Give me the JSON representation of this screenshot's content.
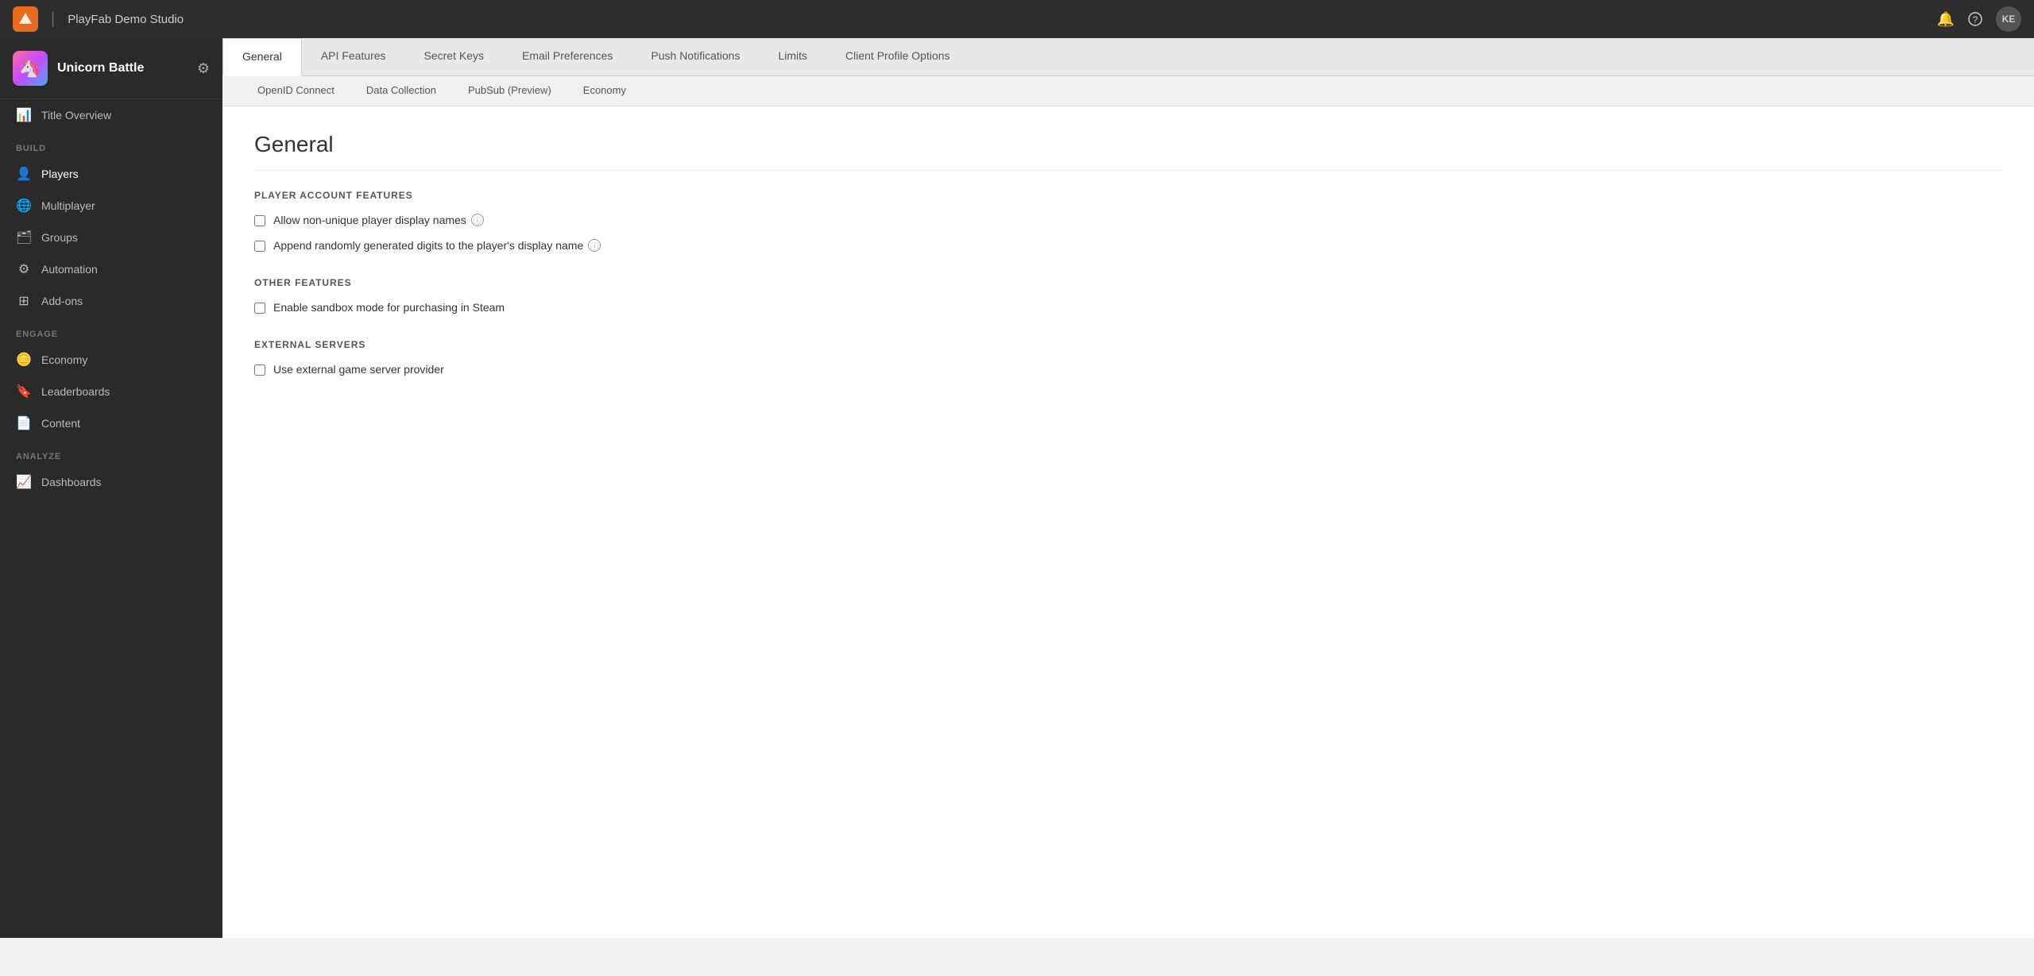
{
  "topbar": {
    "logo_text": "▲",
    "studio_name": "PlayFab Demo Studio",
    "avatar_text": "KE"
  },
  "sidebar": {
    "game_icon": "🦄",
    "game_title": "Unicorn Battle",
    "title_overview_label": "Title Overview",
    "section_build": "BUILD",
    "nav_players": "Players",
    "nav_multiplayer": "Multiplayer",
    "nav_groups": "Groups",
    "nav_automation": "Automation",
    "nav_addons": "Add-ons",
    "section_engage": "ENGAGE",
    "nav_economy": "Economy",
    "nav_leaderboards": "Leaderboards",
    "nav_content": "Content",
    "section_analyze": "ANALYZE",
    "nav_dashboards": "Dashboards"
  },
  "tabs_primary": {
    "items": [
      {
        "label": "General",
        "active": true
      },
      {
        "label": "API Features",
        "active": false
      },
      {
        "label": "Secret Keys",
        "active": false
      },
      {
        "label": "Email Preferences",
        "active": false
      },
      {
        "label": "Push Notifications",
        "active": false
      },
      {
        "label": "Limits",
        "active": false
      },
      {
        "label": "Client Profile Options",
        "active": false
      }
    ]
  },
  "tabs_secondary": {
    "items": [
      {
        "label": "OpenID Connect",
        "active": false
      },
      {
        "label": "Data Collection",
        "active": false
      },
      {
        "label": "PubSub (Preview)",
        "active": false
      },
      {
        "label": "Economy",
        "active": false
      }
    ]
  },
  "content": {
    "page_title": "General",
    "section_player_account": "PLAYER ACCOUNT FEATURES",
    "checkbox_non_unique_names": "Allow non-unique player display names",
    "checkbox_append_digits": "Append randomly generated digits to the player's display name",
    "section_other_features": "OTHER FEATURES",
    "checkbox_sandbox_mode": "Enable sandbox mode for purchasing in Steam",
    "section_external_servers": "EXTERNAL SERVERS",
    "checkbox_external_server": "Use external game server provider"
  }
}
